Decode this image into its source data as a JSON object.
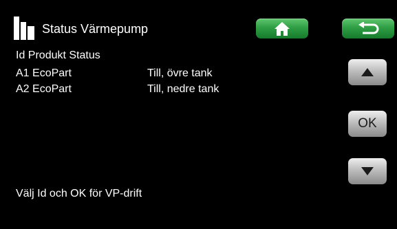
{
  "header": {
    "title": "Status Värmepump"
  },
  "toolbar": {
    "home_icon": "home-icon",
    "back_icon": "return-arrow-icon"
  },
  "side_buttons": {
    "up_icon": "arrow-up-icon",
    "ok_label": "OK",
    "down_icon": "arrow-down-icon"
  },
  "table": {
    "columns_label": "Id Produkt Status",
    "rows": [
      {
        "id": "A1 EcoPart",
        "status": "Till, övre tank"
      },
      {
        "id": "A2 EcoPart",
        "status": "Till, nedre tank"
      }
    ]
  },
  "footer": {
    "hint": "Välj Id och OK för VP-drift"
  },
  "colors": {
    "background": "#000000",
    "green_button": "#2f9e45",
    "gray_button": "#bdbdbd",
    "text": "#ffffff"
  }
}
